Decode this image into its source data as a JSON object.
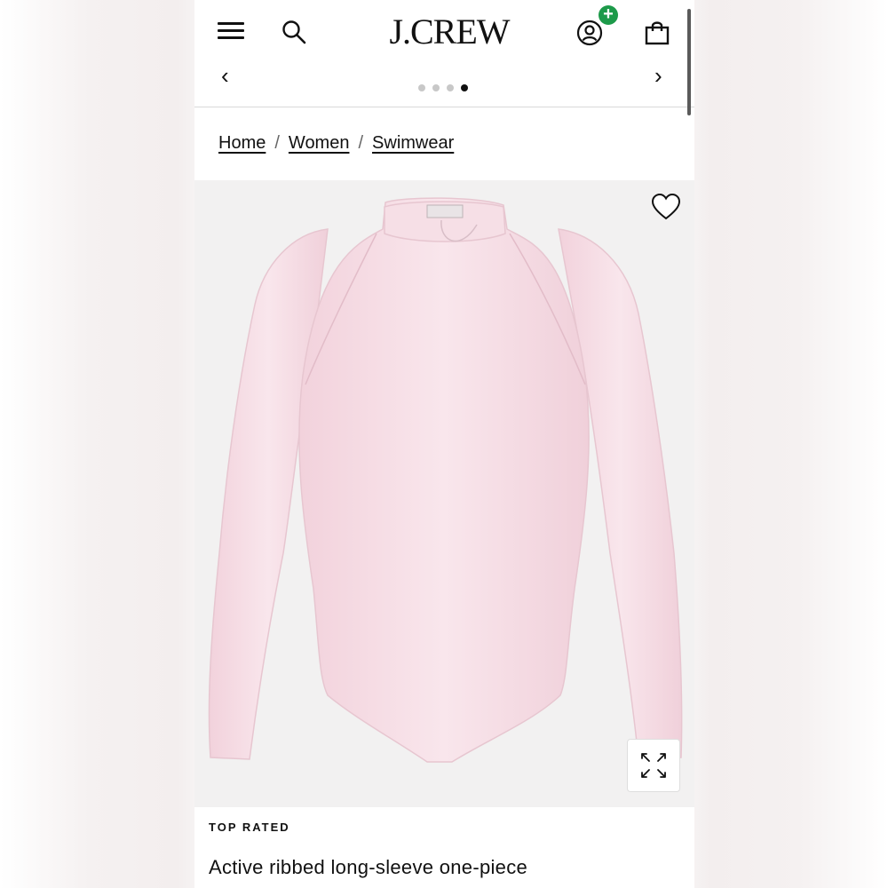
{
  "header": {
    "logo": "J.CREW",
    "menu_icon": "hamburger-menu-icon",
    "search_icon": "search-icon",
    "account_icon": "account-icon",
    "account_badge": "+",
    "bag_icon": "shopping-bag-icon"
  },
  "carousel": {
    "prev_label": "‹",
    "next_label": "›",
    "dot_count": 4,
    "active_dot": 4
  },
  "breadcrumb": {
    "items": [
      "Home",
      "Women",
      "Swimwear"
    ],
    "separator": "/"
  },
  "product": {
    "badge": "TOP RATED",
    "name": "Active ribbed long-sleeve one-piece",
    "wishlist_icon": "heart-icon",
    "expand_icon": "expand-icon",
    "image_alt": "pink long-sleeve swimsuit",
    "colors": {
      "garment": "#f7dfe6",
      "garment_shade": "#efd0da",
      "image_bg": "#f2f1f1"
    }
  },
  "colors": {
    "badge_green": "#1d9a4a",
    "text": "#111111"
  }
}
